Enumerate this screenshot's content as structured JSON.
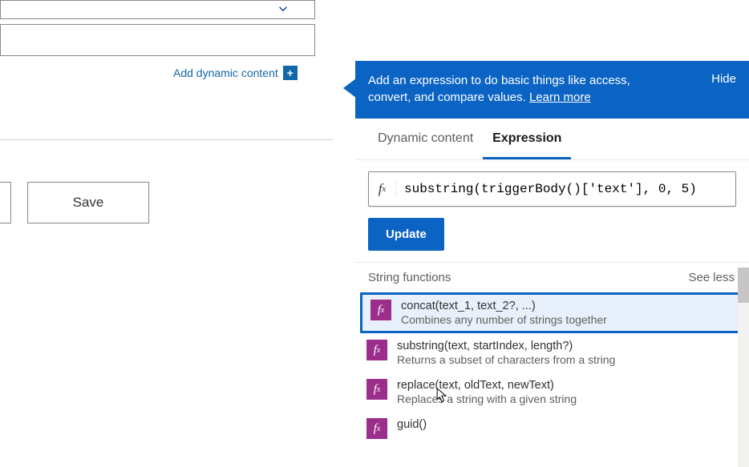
{
  "left": {
    "add_dynamic_label": "Add dynamic content",
    "save_label": "Save"
  },
  "panel": {
    "banner_text_prefix": "Add an expression to do basic things like access, convert, and compare values. ",
    "banner_learn_more": "Learn more",
    "hide_label": "Hide",
    "tabs": {
      "dynamic": "Dynamic content",
      "expression": "Expression"
    },
    "fx_symbol": "fx",
    "expression_value": "substring(triggerBody()['text'], 0, 5)",
    "update_label": "Update",
    "section_title": "String functions",
    "see_less_label": "See less",
    "functions": [
      {
        "sig": "concat(text_1, text_2?, ...)",
        "desc": "Combines any number of strings together"
      },
      {
        "sig": "substring(text, startIndex, length?)",
        "desc": "Returns a subset of characters from a string"
      },
      {
        "sig": "replace(text, oldText, newText)",
        "desc": "Replaces a string with a given string"
      },
      {
        "sig": "guid()",
        "desc": ""
      }
    ]
  }
}
